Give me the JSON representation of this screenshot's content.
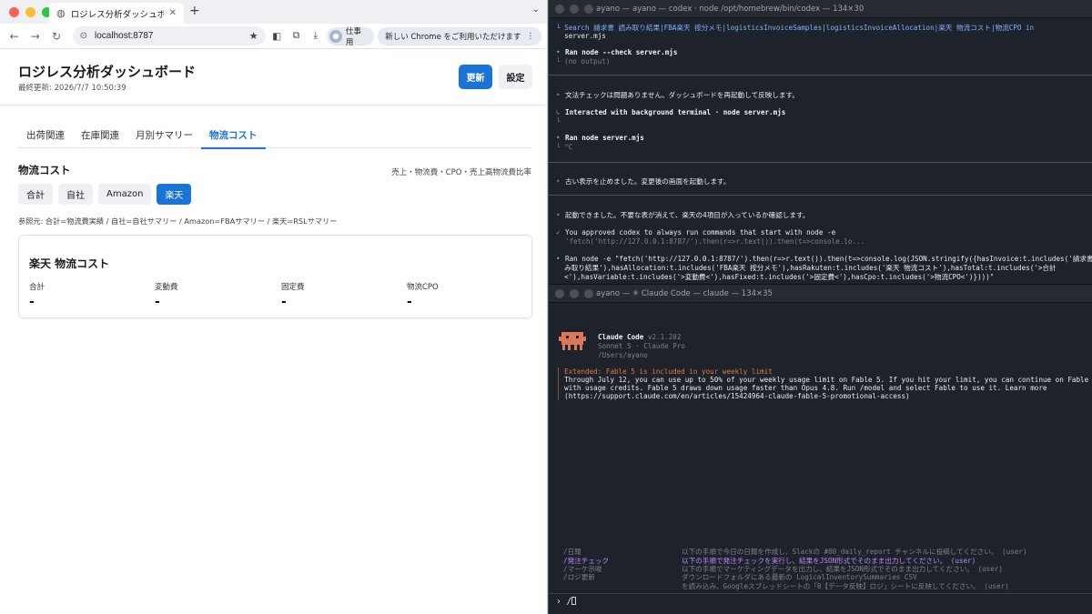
{
  "browser": {
    "tab_title": "ロジレス分析ダッシュボード",
    "url": "localhost:8787",
    "profile_label": "仕事用",
    "chrome_banner": "新しい Chrome をご利用いただけます"
  },
  "dashboard": {
    "title": "ロジレス分析ダッシュボード",
    "updated": "最終更新: 2026/7/7 10:50:39",
    "refresh_label": "更新",
    "settings_label": "設定",
    "tabs": [
      {
        "label": "出荷関連",
        "active": false
      },
      {
        "label": "在庫関連",
        "active": false
      },
      {
        "label": "月別サマリー",
        "active": false
      },
      {
        "label": "物流コスト",
        "active": true
      }
    ],
    "section_title": "物流コスト",
    "section_note": "売上・物流費・CPO・売上高物流費比率",
    "filters": [
      {
        "label": "合計",
        "active": false
      },
      {
        "label": "自社",
        "active": false
      },
      {
        "label": "Amazon",
        "active": false
      },
      {
        "label": "楽天",
        "active": true
      }
    ],
    "reference": "参照元: 合計=物流費実績 / 自社=自社サマリー / Amazon=FBAサマリー / 楽天=RSLサマリー",
    "card_title": "楽天 物流コスト",
    "metrics": [
      {
        "label": "合計",
        "value": "-"
      },
      {
        "label": "変動費",
        "value": "-"
      },
      {
        "label": "固定費",
        "value": "-"
      },
      {
        "label": "物流CPO",
        "value": "-"
      }
    ]
  },
  "term1": {
    "title": "ayano — ayano — codex · node /opt/homebrew/bin/codex — 134×30",
    "search_line": "└ Search 請求書 読み取り結果|FBA楽天 按分メモ|logisticsInvoiceSamples|logisticsInvoiceAllocation|楽天 物流コスト|物流CPO in",
    "search_line2": "  server.mjs",
    "ran1_cmd": "Ran node --check server.mjs",
    "ran1_out": "└ (no output)",
    "msg1": "文法チェックは問題ありません。ダッシュボードを再起動して反映します。",
    "interact": "Interacted with background terminal · node server.mjs",
    "interact_sub": "└",
    "ran2_cmd": "Ran node server.mjs",
    "ran2_out": "└ ^C",
    "msg2": "古い表示を止めました。変更後の画面を起動します。",
    "msg3": "起動できました。不要な表が消えて、楽天の4項目が入っているか確認します。",
    "approved1": "You approved codex to always run commands that start with node -e",
    "approved2": "'fetch('http://127.0.0.1:8787/').then(r=>r.text()).then(t=>console.lo...",
    "ran3_1": "Ran node -e \"fetch('http://127.0.0.1:8787/').then(r=>r.text()).then(t=>console.log(JSON.stringify({hasInvoice:t.includes('請求書 読",
    "ran3_2": "  み取り結果'),hasAllocation:t.includes('FBA楽天 按分メモ'),hasRakuten:t.includes('楽天 物流コスト'),hasTotal:t.includes('>合計",
    "ran3_3": "  <'),hasVariable:t.includes('>変動費<'),hasFixed:t.includes('>固定費<'),hasCpo:t.includes('>物流CPO<')})))\""
  },
  "term2": {
    "title": "ayano — ✳ Claude Code — claude — 134×35",
    "app_name": "Claude Code",
    "version": "v2.1.202",
    "model": "Sonnet 5 · Claude Pro",
    "cwd": "/Users/ayano",
    "notice_title": "Extended: Fable 5 is included in your weekly limit",
    "notice_1": "Through July 12, you can use up to 50% of your weekly usage limit on Fable 5. If you hit your limit, you can continue on Fable 5",
    "notice_2": "with usage credits. Fable 5 draws down usage faster than Opus 4.8. Run /model and select Fable to use it. Learn more",
    "notice_3": "(https://support.claude.com/en/articles/15424964-claude-fable-5-promotional-access)",
    "commands": [
      {
        "name": "/日報",
        "desc": "以下の手順で今日の日報を作成し、Slackの #00_daily_report チャンネルに投稿してください。 (user)",
        "selected": false
      },
      {
        "name": "/発注チェック",
        "desc": "以下の手順で発注チェックを実行し、結果をJSON形式でそのまま出力してください。 (user)",
        "selected": true
      },
      {
        "name": "/マーケ示唆",
        "desc": "以下の手順でマーケティングデータを出力し、結果をJSON形式でそのまま出力してください。 (user)",
        "selected": false
      },
      {
        "name": "/ロジ更新",
        "desc": "ダウンロードフォルダにある最新の LogicalInventorySummaries CSV",
        "selected": false
      }
    ],
    "cmd_desc_cont": "を読み込み、Googleスプレッドシートの「0【データ反映】ロジ」シートに反映してください。 (user)",
    "prompt_symbol": "›",
    "prompt_value": "/"
  }
}
